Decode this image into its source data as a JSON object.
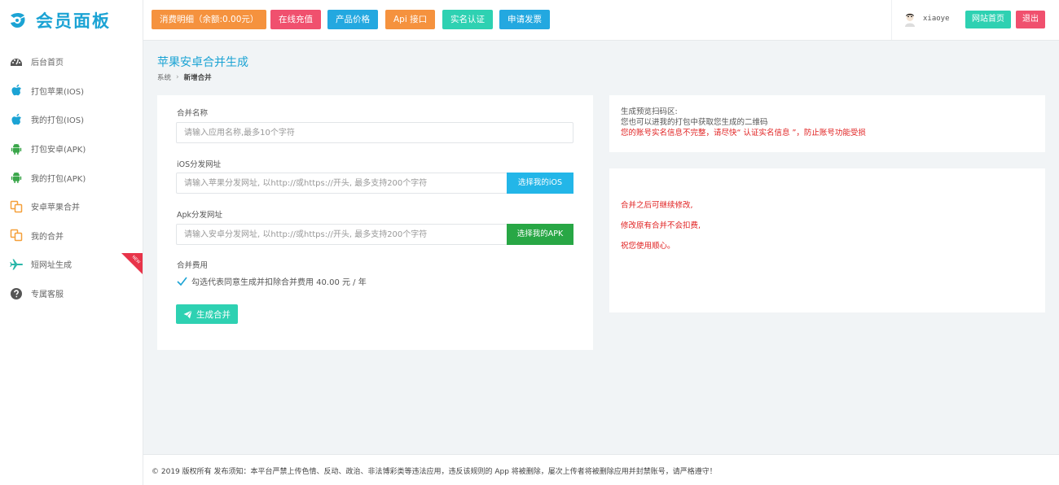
{
  "brand": {
    "name": "会员面板",
    "color": "#1ba3d4"
  },
  "sidebar": {
    "items": [
      {
        "label": "后台首页",
        "icon": "dashboard-icon"
      },
      {
        "label": "打包苹果(IOS)",
        "icon": "apple-icon"
      },
      {
        "label": "我的打包(IOS)",
        "icon": "apple-icon"
      },
      {
        "label": "打包安卓(APK)",
        "icon": "android-icon"
      },
      {
        "label": "我的打包(APK)",
        "icon": "android-icon"
      },
      {
        "label": "安卓苹果合并",
        "icon": "copy-icon"
      },
      {
        "label": "我的合并",
        "icon": "copy-icon"
      },
      {
        "label": "短网址生成",
        "icon": "plane-icon",
        "badge": "NEW"
      },
      {
        "label": "专属客服",
        "icon": "question-icon"
      }
    ]
  },
  "topbar": {
    "buttons": [
      {
        "label": "消费明细（余额:0.00元）",
        "color": "#f5923e"
      },
      {
        "label": "在线充值",
        "color": "#f0506e"
      },
      {
        "label": "产品价格",
        "color": "#23a8e0"
      },
      {
        "label": "Api 接口",
        "color": "#f5923e"
      },
      {
        "label": "实名认证",
        "color": "#2ed1b2"
      },
      {
        "label": "申请发票",
        "color": "#23a8e0"
      }
    ],
    "user": {
      "name": "xiaoye",
      "home_label": "网站首页",
      "logout_label": "退出"
    }
  },
  "page": {
    "title": "苹果安卓合并生成",
    "breadcrumb": [
      "系统",
      "新增合并"
    ]
  },
  "form": {
    "name": {
      "label": "合并名称",
      "placeholder": "请输入应用名称,最多10个字符"
    },
    "ios": {
      "label": "iOS分发网址",
      "placeholder": "请输入苹果分发网址, 以http://或https://开头, 最多支持200个字符",
      "button": "选择我的iOS"
    },
    "apk": {
      "label": "Apk分发网址",
      "placeholder": "请输入安卓分发网址, 以http://或https://开头, 最多支持200个字符",
      "button": "选择我的APK"
    },
    "fee": {
      "label": "合并费用",
      "checkbox_text": "勾选代表同意生成并扣除合并费用 40.00 元 / 年",
      "checked": true
    },
    "submit": "生成合并"
  },
  "preview": {
    "title": "生成预览扫码区:",
    "line2": "您也可以进我的打包中获取您生成的二维码",
    "warning": "您的账号实名信息不完整，请尽快“ 认证实名信息 ”，防止账号功能受损"
  },
  "notes": [
    "合并之后可继续修改,",
    "修改原有合并不会扣费,",
    "祝您使用顺心。"
  ],
  "footer": {
    "text": "© 2019 版权所有 发布须知：本平台严禁上传色情、反动、政治、非法博彩类等违法应用，违反该规则的 App 将被删除，屡次上传者将被删除应用并封禁账号，请严格遵守！"
  }
}
